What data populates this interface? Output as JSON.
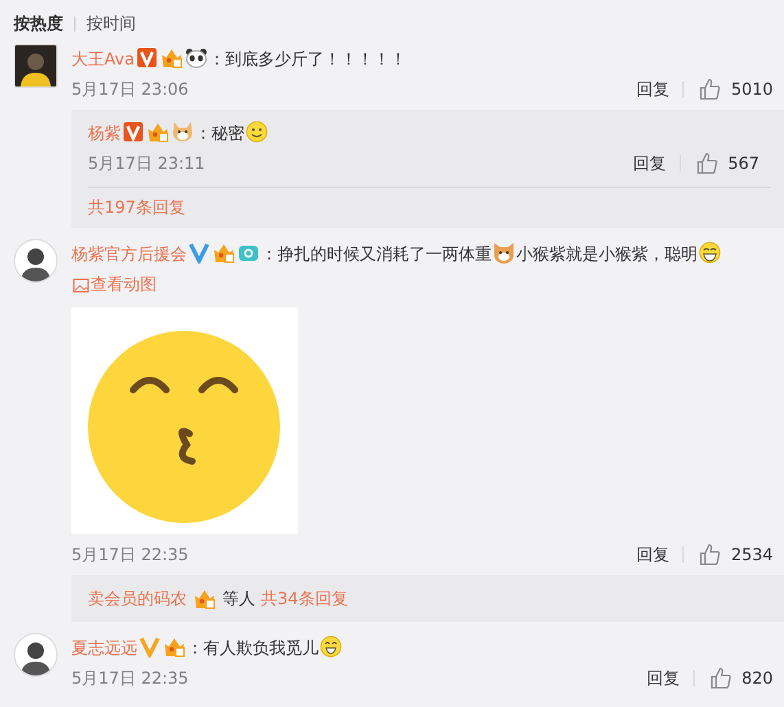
{
  "sort_tabs": [
    {
      "label": "按热度",
      "selected": true
    },
    {
      "label": "按时间",
      "selected": false
    }
  ],
  "comments": [
    {
      "avatar": {
        "kind": "square"
      },
      "name": "大王Ava",
      "badges": [
        {
          "kind": "boxed",
          "color": "#e8541e"
        },
        {
          "kind": "vip"
        }
      ],
      "content": [
        {
          "kind": "panda"
        },
        {
          "kind": "text",
          "text": "：到底多少斤了！！！！！"
        }
      ],
      "date": "5月17日 23:06",
      "reply_label": "回复",
      "likes": "5010",
      "replies": [
        {
          "name": "杨紫",
          "badges": [
            {
              "kind": "boxed",
              "color": "#e8541e"
            },
            {
              "kind": "vip"
            }
          ],
          "content": [
            {
              "kind": "dog"
            },
            {
              "kind": "text",
              "text": "：秘密"
            },
            {
              "kind": "smile"
            }
          ],
          "date": "5月17日 23:11",
          "reply_label": "回复",
          "likes": "567"
        }
      ],
      "more_link": "共197条回复"
    },
    {
      "avatar": {
        "kind": "round"
      },
      "name": "杨紫官方后援会",
      "badges": [
        {
          "kind": "plain",
          "color": "#3b9be6"
        },
        {
          "kind": "vip"
        },
        {
          "kind": "camera"
        }
      ],
      "content": [
        {
          "kind": "text",
          "text": "：挣扎的时候又消耗了一两体重"
        },
        {
          "kind": "cat"
        },
        {
          "kind": "text",
          "text": "小猴紫就是小猴紫，聪明"
        },
        {
          "kind": "laugh"
        }
      ],
      "gif_link": "查看动图",
      "attachment": {
        "kind": "kiss"
      },
      "date": "5月17日 22:35",
      "reply_label": "回复",
      "likes": "2534",
      "summary": {
        "names": [
          "卖会员的码农"
        ],
        "text": "等人",
        "count_link": "共34条回复"
      }
    },
    {
      "avatar": {
        "kind": "round"
      },
      "name": "夏志远远",
      "badges": [
        {
          "kind": "plain",
          "color": "#f5a623"
        },
        {
          "kind": "vip"
        }
      ],
      "content": [
        {
          "kind": "text",
          "text": "：有人欺负我觅儿"
        },
        {
          "kind": "grin"
        }
      ],
      "date": "5月17日 22:35",
      "reply_label": "回复",
      "likes": "820"
    }
  ]
}
